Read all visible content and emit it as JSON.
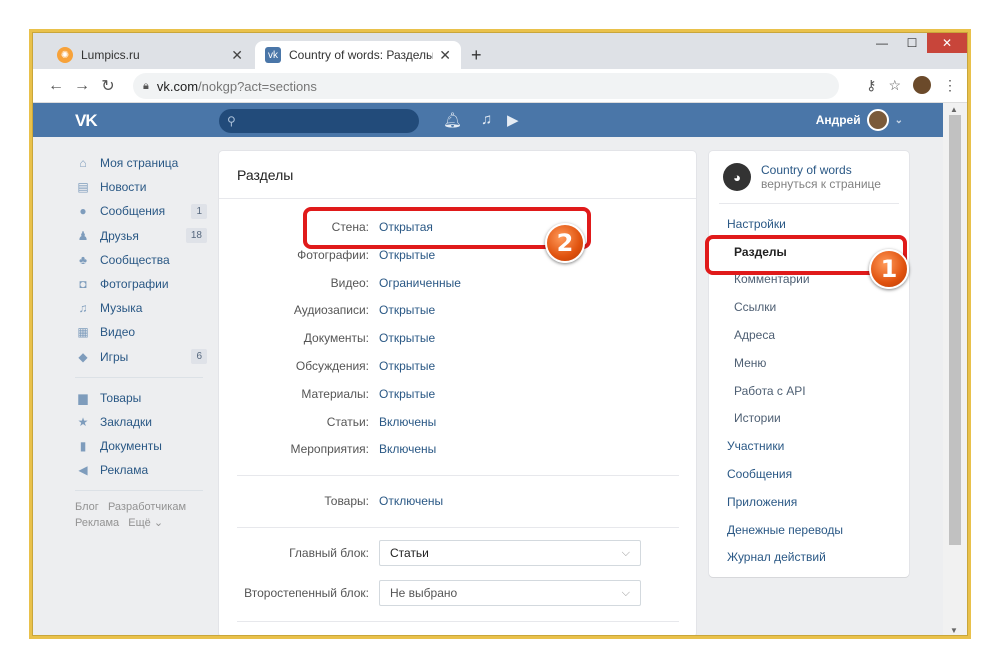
{
  "browser": {
    "tabs": [
      {
        "title": "Lumpics.ru",
        "active": false
      },
      {
        "title": "Country of words: Разделы",
        "active": true
      }
    ],
    "url_host": "vk.com",
    "url_path": "/nokgp?act=sections"
  },
  "vk_header": {
    "logo": "VK",
    "user_name": "Андрей"
  },
  "left_nav": {
    "items": [
      {
        "label": "Моя страница",
        "icon": "home-icon",
        "glyph": "⌂"
      },
      {
        "label": "Новости",
        "icon": "news-icon",
        "glyph": "▤"
      },
      {
        "label": "Сообщения",
        "icon": "message-icon",
        "glyph": "●",
        "count": "1"
      },
      {
        "label": "Друзья",
        "icon": "friends-icon",
        "glyph": "♟",
        "count": "18"
      },
      {
        "label": "Сообщества",
        "icon": "groups-icon",
        "glyph": "♣"
      },
      {
        "label": "Фотографии",
        "icon": "camera-icon",
        "glyph": "◘"
      },
      {
        "label": "Музыка",
        "icon": "music-icon",
        "glyph": "♫"
      },
      {
        "label": "Видео",
        "icon": "video-icon",
        "glyph": "▦"
      },
      {
        "label": "Игры",
        "icon": "games-icon",
        "glyph": "◆",
        "count": "6"
      }
    ],
    "items2": [
      {
        "label": "Товары",
        "icon": "bag-icon",
        "glyph": "▆"
      },
      {
        "label": "Закладки",
        "icon": "star-icon",
        "glyph": "★"
      },
      {
        "label": "Документы",
        "icon": "document-icon",
        "glyph": "▮"
      },
      {
        "label": "Реклама",
        "icon": "megaphone-icon",
        "glyph": "◀"
      }
    ],
    "footer": {
      "blog": "Блог",
      "dev": "Разработчикам",
      "ads": "Реклама",
      "more": "Ещё"
    }
  },
  "main": {
    "title": "Разделы",
    "rows": [
      {
        "label": "Стена:",
        "value": "Открытая"
      },
      {
        "label": "Фотографии:",
        "value": "Открытые"
      },
      {
        "label": "Видео:",
        "value": "Ограниченные"
      },
      {
        "label": "Аудиозаписи:",
        "value": "Открытые"
      },
      {
        "label": "Документы:",
        "value": "Открытые"
      },
      {
        "label": "Обсуждения:",
        "value": "Открытые"
      },
      {
        "label": "Материалы:",
        "value": "Открытые"
      },
      {
        "label": "Статьи:",
        "value": "Включены"
      },
      {
        "label": "Мероприятия:",
        "value": "Включены"
      }
    ],
    "goods": {
      "label": "Товары:",
      "value": "Отключены"
    },
    "main_block": {
      "label": "Главный блок:",
      "value": "Статьи"
    },
    "secondary_block": {
      "label": "Второстепенный блок:",
      "value": "Не выбрано"
    }
  },
  "right_menu": {
    "group_name": "Country of words",
    "back_link": "вернуться к странице",
    "items": [
      {
        "label": "Настройки",
        "sub": false
      },
      {
        "label": "Разделы",
        "sub": true,
        "selected": true
      },
      {
        "label": "Комментарии",
        "sub": true
      },
      {
        "label": "Ссылки",
        "sub": true
      },
      {
        "label": "Адреса",
        "sub": true
      },
      {
        "label": "Меню",
        "sub": true
      },
      {
        "label": "Работа с API",
        "sub": true
      },
      {
        "label": "Истории",
        "sub": true
      },
      {
        "label": "Участники",
        "sub": false
      },
      {
        "label": "Сообщения",
        "sub": false
      },
      {
        "label": "Приложения",
        "sub": false
      },
      {
        "label": "Денежные переводы",
        "sub": false
      },
      {
        "label": "Журнал действий",
        "sub": false
      }
    ]
  },
  "annotations": {
    "badge1": "1",
    "badge2": "2",
    "highlight_color": "#e01a1a"
  },
  "colors": {
    "vk_blue": "#4a76a8",
    "link": "#2a5885"
  }
}
